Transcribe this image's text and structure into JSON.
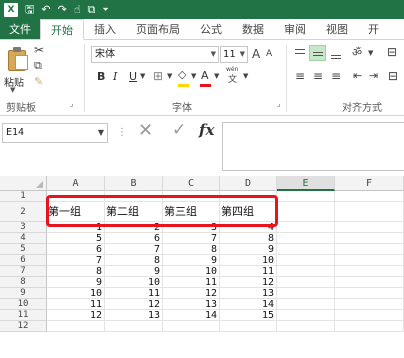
{
  "app": {
    "logo_text": "X"
  },
  "quick_access": {
    "icons": [
      "excel-logo-icon",
      "save-icon",
      "undo-icon",
      "redo-icon",
      "touch-mode-icon",
      "print-preview-icon",
      "customize-icon"
    ],
    "glyphs": {
      "save": "🖫",
      "undo": "↶",
      "redo": "↷",
      "touch": "☝",
      "preview": "⧉",
      "customize": "⏷"
    }
  },
  "ribbon_tabs": [
    "文件",
    "开始",
    "插入",
    "页面布局",
    "公式",
    "数据",
    "审阅",
    "视图",
    "开"
  ],
  "active_tab": "开始",
  "ribbon": {
    "paste_label": "粘贴",
    "clipboard_label": "剪贴板",
    "font_name": "宋体",
    "font_size": "11",
    "grow_font": "A",
    "shrink_font": "A",
    "bold": "B",
    "italic": "I",
    "underline": "U",
    "font_color_letter": "A",
    "wen_label": "wén",
    "wen_char": "文",
    "font_group_label": "字体",
    "align_group_label": "对齐方式",
    "font_color": "#e8141d",
    "highlight_color": "#ffd800",
    "accent_color": "#217346"
  },
  "formula_bar": {
    "name_box": "E14",
    "cancel_glyph": "✕",
    "enter_glyph": "✓",
    "fx_label": "fx",
    "formula": ""
  },
  "grid": {
    "columns": [
      "A",
      "B",
      "C",
      "D",
      "E",
      "F"
    ],
    "selected_column": "E",
    "row_numbers": [
      "1",
      "2",
      "3",
      "4",
      "5",
      "6",
      "7",
      "8",
      "9",
      "10",
      "11",
      "12"
    ],
    "header_row": [
      "第一组",
      "第二组",
      "第三组",
      "第四组"
    ],
    "data_rows": [
      [
        "1",
        "2",
        "3",
        "4"
      ],
      [
        "5",
        "6",
        "7",
        "8"
      ],
      [
        "6",
        "7",
        "8",
        "9"
      ],
      [
        "7",
        "8",
        "9",
        "10"
      ],
      [
        "8",
        "9",
        "10",
        "11"
      ],
      [
        "9",
        "10",
        "11",
        "12"
      ],
      [
        "10",
        "11",
        "12",
        "13"
      ],
      [
        "11",
        "12",
        "13",
        "14"
      ],
      [
        "12",
        "13",
        "14",
        "15"
      ]
    ]
  },
  "highlight_border_color": "#e8141d"
}
